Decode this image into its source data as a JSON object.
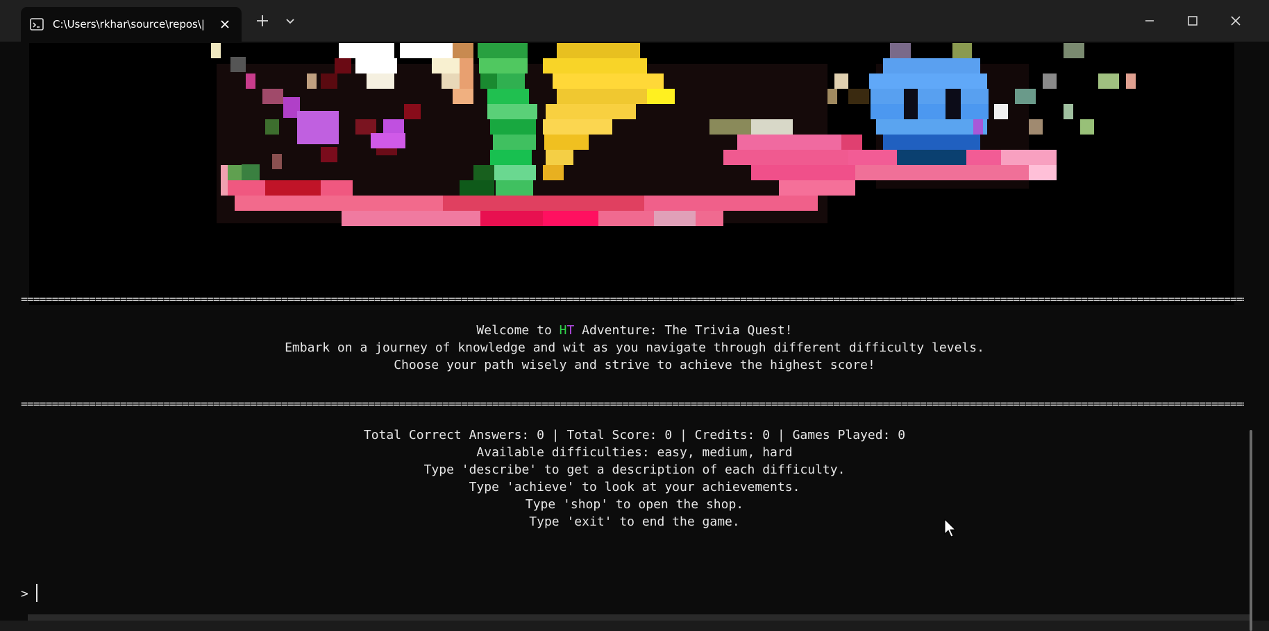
{
  "window": {
    "tab_title": "C:\\Users\\rkhar\\source\\repos\\|",
    "icons": [
      "terminal-icon",
      "close-icon",
      "plus-icon",
      "chevron-down-icon",
      "minimize-icon",
      "maximize-icon",
      "close-window-icon"
    ]
  },
  "terminal": {
    "separator": "==================================================================================================================================================================================================================",
    "welcome": {
      "prefix": "Welcome to ",
      "h": "H",
      "t": "T",
      "suffix": " Adventure: The Trivia Quest!"
    },
    "intro_line_2": "Embark on a journey of knowledge and wit as you navigate through different difficulty levels.",
    "intro_line_3": "Choose your path wisely and strive to achieve the highest score!",
    "stats_line": "Total Correct Answers: 0 | Total Score: 0 | Credits: 0 | Games Played: 0",
    "difficulties_line": "Available difficulties: easy, medium, hard",
    "describe_line": "Type 'describe' to get a description of each difficulty.",
    "achieve_line": "Type 'achieve' to look at your achievements.",
    "shop_line": "Type 'shop' to open the shop.",
    "exit_line": "Type 'exit' to end the game.",
    "prompt": ">"
  },
  "colors": {
    "accent_green": "#2fd24a",
    "accent_purple": "#b04ae0",
    "background": "#0c0c0c",
    "titlebar": "#202020"
  }
}
